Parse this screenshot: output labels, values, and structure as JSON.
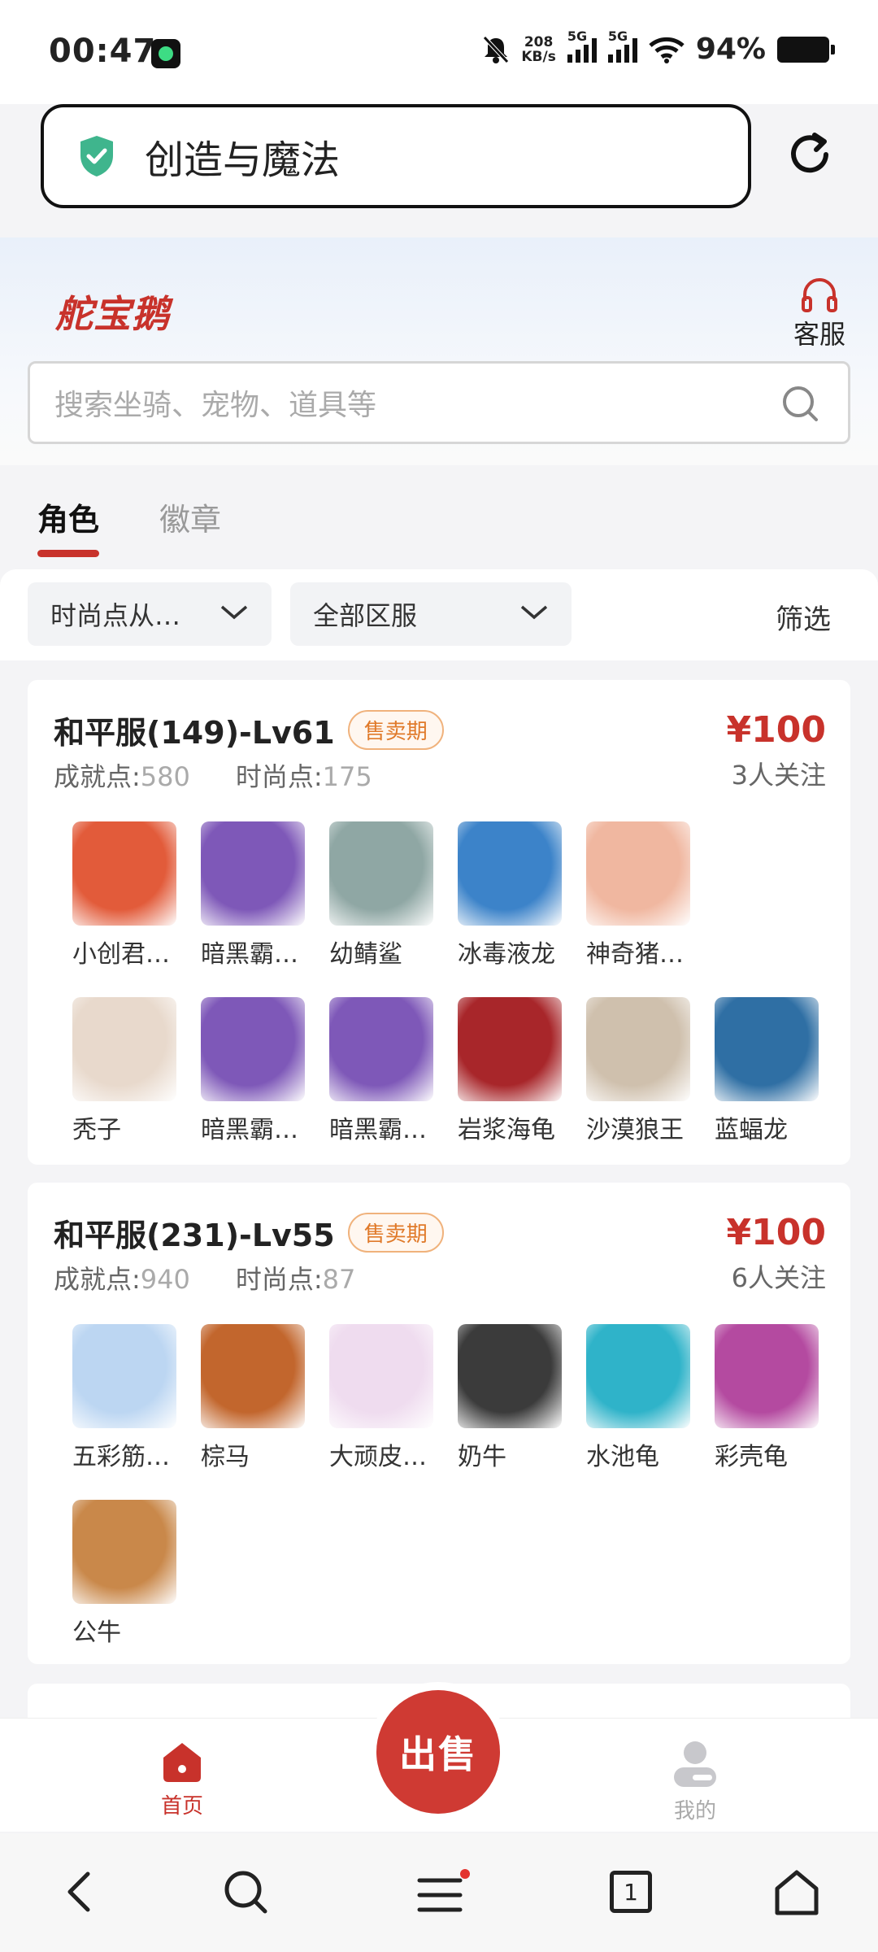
{
  "status_bar": {
    "time": "00:47",
    "speed_value": "208",
    "speed_unit": "KB/s",
    "network1": "5G",
    "network2": "5G",
    "battery": "94%"
  },
  "browser": {
    "url_title": "创造与魔法"
  },
  "header": {
    "logo": "舵宝鹅",
    "service_label": "客服",
    "search_placeholder": "搜索坐骑、宠物、道具等"
  },
  "tabs": [
    {
      "label": "角色",
      "active": true
    },
    {
      "label": "徽章",
      "active": false
    }
  ],
  "filters": {
    "sort_label": "时尚点从…",
    "server_label": "全部区服",
    "filter_label": "筛选"
  },
  "listings": [
    {
      "title": "和平服(149)-Lv61",
      "badge": "售卖期",
      "achievement_label": "成就点:",
      "achievement_value": "580",
      "fashion_label": "时尚点:",
      "fashion_value": "175",
      "price": "¥100",
      "followers": "3人关注",
      "items": [
        {
          "name": "小创君…",
          "color": "#e25b3a"
        },
        {
          "name": "暗黑霸…",
          "color": "#7e58b8"
        },
        {
          "name": "幼鲭鲨",
          "color": "#8fa7a4"
        },
        {
          "name": "冰毒液龙",
          "color": "#3c83c9"
        },
        {
          "name": "神奇猪…",
          "color": "#f0b7a0"
        },
        {
          "name": "",
          "color": "#ffffff"
        },
        {
          "name": "秃子",
          "color": "#e8d9cc"
        },
        {
          "name": "暗黑霸…",
          "color": "#7e58b8"
        },
        {
          "name": "暗黑霸…",
          "color": "#7e58b8"
        },
        {
          "name": "岩浆海龟",
          "color": "#a8262a"
        },
        {
          "name": "沙漠狼王",
          "color": "#cfc0ad"
        },
        {
          "name": "蓝蝠龙",
          "color": "#2f6fa4"
        }
      ]
    },
    {
      "title": "和平服(231)-Lv55",
      "badge": "售卖期",
      "achievement_label": "成就点:",
      "achievement_value": "940",
      "fashion_label": "时尚点:",
      "fashion_value": "87",
      "price": "¥100",
      "followers": "6人关注",
      "items": [
        {
          "name": "五彩筋…",
          "color": "#bcd6f2"
        },
        {
          "name": "棕马",
          "color": "#c2662d"
        },
        {
          "name": "大顽皮…",
          "color": "#efdcef"
        },
        {
          "name": "奶牛",
          "color": "#3b3b3b"
        },
        {
          "name": "水池龟",
          "color": "#2fb3c9"
        },
        {
          "name": "彩壳龟",
          "color": "#b44aa0"
        },
        {
          "name": "公牛",
          "color": "#c9884a"
        }
      ]
    }
  ],
  "bottom_nav": {
    "home_label": "首页",
    "sell_label": "出售",
    "mine_label": "我的"
  },
  "browser_bar": {
    "tab_count": "1"
  },
  "colors": {
    "brand_red": "#c8322b",
    "badge_orange": "#e07a2a"
  }
}
